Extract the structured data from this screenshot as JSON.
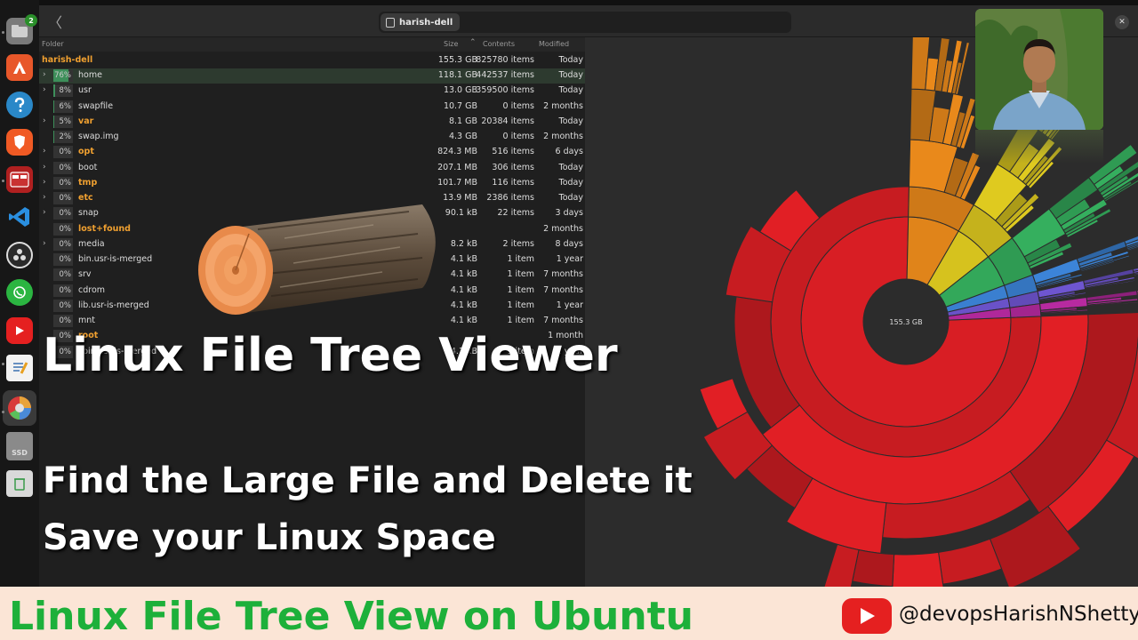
{
  "dock": {
    "files_badge": "2",
    "ssd_label": "SSD"
  },
  "header": {
    "back_label": "〈",
    "breadcrumb": "harish-dell",
    "close_label": "✕"
  },
  "columns": {
    "folder": "Folder",
    "size": "Size",
    "contents": "Contents",
    "modified": "Modified"
  },
  "root_row": {
    "name": "harish-dell",
    "size": "155.3 GB",
    "items": "825780 items",
    "modified": "Today"
  },
  "rows": [
    {
      "expand": "›",
      "pct": "76%",
      "fill": 0.76,
      "name": "home",
      "dir": false,
      "size": "118.1 GB",
      "items": "442537 items",
      "modified": "Today"
    },
    {
      "expand": "›",
      "pct": "8%",
      "fill": 0.08,
      "name": "usr",
      "dir": false,
      "size": "13.0 GB",
      "items": "359500 items",
      "modified": "Today"
    },
    {
      "expand": "",
      "pct": "6%",
      "fill": 0.06,
      "name": "swapfile",
      "dir": false,
      "size": "10.7 GB",
      "items": "0 items",
      "modified": "2 months"
    },
    {
      "expand": "›",
      "pct": "5%",
      "fill": 0.05,
      "name": "var",
      "dir": true,
      "size": "8.1 GB",
      "items": "20384 items",
      "modified": "Today"
    },
    {
      "expand": "",
      "pct": "2%",
      "fill": 0.02,
      "name": "swap.img",
      "dir": false,
      "size": "4.3 GB",
      "items": "0 items",
      "modified": "2 months"
    },
    {
      "expand": "›",
      "pct": "0%",
      "fill": 0,
      "name": "opt",
      "dir": true,
      "size": "824.3 MB",
      "items": "516 items",
      "modified": "6 days"
    },
    {
      "expand": "›",
      "pct": "0%",
      "fill": 0,
      "name": "boot",
      "dir": false,
      "size": "207.1 MB",
      "items": "306 items",
      "modified": "Today"
    },
    {
      "expand": "›",
      "pct": "0%",
      "fill": 0,
      "name": "tmp",
      "dir": true,
      "size": "101.7 MB",
      "items": "116 items",
      "modified": "Today"
    },
    {
      "expand": "›",
      "pct": "0%",
      "fill": 0,
      "name": "etc",
      "dir": true,
      "size": "13.9 MB",
      "items": "2386 items",
      "modified": "Today"
    },
    {
      "expand": "›",
      "pct": "0%",
      "fill": 0,
      "name": "snap",
      "dir": false,
      "size": "90.1 kB",
      "items": "22 items",
      "modified": "3 days"
    },
    {
      "expand": "",
      "pct": "0%",
      "fill": 0,
      "name": "lost+found",
      "dir": true,
      "size": "",
      "items": "",
      "modified": "2 months"
    },
    {
      "expand": "›",
      "pct": "0%",
      "fill": 0,
      "name": "media",
      "dir": false,
      "size": "8.2 kB",
      "items": "2 items",
      "modified": "8 days"
    },
    {
      "expand": "",
      "pct": "0%",
      "fill": 0,
      "name": "bin.usr-is-merged",
      "dir": false,
      "size": "4.1 kB",
      "items": "1 item",
      "modified": "1 year"
    },
    {
      "expand": "",
      "pct": "0%",
      "fill": 0,
      "name": "srv",
      "dir": false,
      "size": "4.1 kB",
      "items": "1 item",
      "modified": "7 months"
    },
    {
      "expand": "",
      "pct": "0%",
      "fill": 0,
      "name": "cdrom",
      "dir": false,
      "size": "4.1 kB",
      "items": "1 item",
      "modified": "7 months"
    },
    {
      "expand": "",
      "pct": "0%",
      "fill": 0,
      "name": "lib.usr-is-merged",
      "dir": false,
      "size": "4.1 kB",
      "items": "1 item",
      "modified": "1 year"
    },
    {
      "expand": "",
      "pct": "0%",
      "fill": 0,
      "name": "mnt",
      "dir": false,
      "size": "4.1 kB",
      "items": "1 item",
      "modified": "7 months"
    },
    {
      "expand": "",
      "pct": "0%",
      "fill": 0,
      "name": "root",
      "dir": true,
      "size": "",
      "items": "",
      "modified": "1 month"
    },
    {
      "expand": "",
      "pct": "0%",
      "fill": 0,
      "name": "sbin.usr-is-merged",
      "dir": false,
      "size": "4.1 kB",
      "items": "1 item",
      "modified": "1 year"
    }
  ],
  "chart": {
    "center_label": "155.3 GB",
    "ring1": [
      {
        "share": 0.76,
        "color": "#d81e24"
      },
      {
        "share": 0.08,
        "color": "#e0841a"
      },
      {
        "share": 0.06,
        "color": "#d6c21e"
      },
      {
        "share": 0.05,
        "color": "#33a85a"
      },
      {
        "share": 0.02,
        "color": "#3a7fd0"
      },
      {
        "share": 0.015,
        "color": "#6a52c8"
      },
      {
        "share": 0.015,
        "color": "#b0289a"
      }
    ]
  },
  "overlay": {
    "title": "Linux File Tree Viewer",
    "line1": "Find the Large File and Delete it",
    "line2": "Save your Linux Space"
  },
  "banner": {
    "title": "Linux File Tree View on Ubuntu",
    "handle": "@devopsHarishNShetty"
  }
}
